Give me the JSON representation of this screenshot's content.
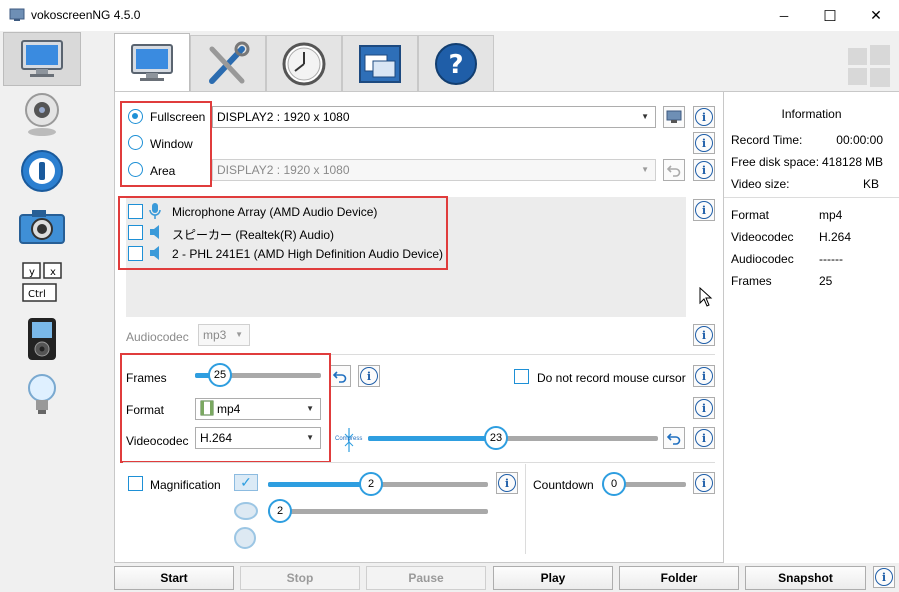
{
  "window": {
    "title": "vokoscreenNG 4.5.0",
    "minimize_glyph": "─",
    "maximize_glyph": "☐",
    "close_glyph": "✕"
  },
  "sidebar": {
    "items": [
      {
        "icon": "monitor-icon",
        "active": true
      },
      {
        "icon": "webcam-icon"
      },
      {
        "icon": "player-icon"
      },
      {
        "icon": "camera-icon"
      },
      {
        "icon": "keyboard-icon",
        "keys": [
          "y",
          "x",
          "Ctrl"
        ]
      },
      {
        "icon": "media-player-icon"
      },
      {
        "icon": "lightbulb-icon"
      }
    ]
  },
  "tabs": [
    {
      "icon": "monitor-icon",
      "active": true
    },
    {
      "icon": "tools-icon"
    },
    {
      "icon": "clock-icon"
    },
    {
      "icon": "window-icon"
    },
    {
      "icon": "help-icon",
      "glyph": "?"
    }
  ],
  "capture": {
    "modes": [
      {
        "label": "Fullscreen",
        "selected": true
      },
      {
        "label": "Window",
        "selected": false
      },
      {
        "label": "Area",
        "selected": false
      }
    ],
    "fullscreen_display": "DISPLAY2 : 1920 x 1080",
    "area_display": "DISPLAY2 : 1920 x 1080"
  },
  "audio": {
    "devices": [
      {
        "label": "Microphone Array (AMD Audio Device)",
        "icon": "microphone-icon",
        "checked": false
      },
      {
        "label": "スピーカー (Realtek(R) Audio)",
        "icon": "speaker-icon",
        "checked": false
      },
      {
        "label": "2 - PHL 241E1 (AMD High Definition Audio Device)",
        "icon": "speaker-icon",
        "checked": false
      }
    ],
    "codec_label": "Audiocodec",
    "codec_value": "mp3"
  },
  "video": {
    "frames_label": "Frames",
    "frames_value": "25",
    "frames_fraction": 0.2,
    "format_label": "Format",
    "format_value": "mp4",
    "videocodec_label": "Videocodec",
    "videocodec_value": "H.264",
    "mouse_cursor_label": "Do not record mouse cursor",
    "compress_label": "Compress",
    "compress_value": "23",
    "compress_fraction": 0.44
  },
  "magnification": {
    "label": "Magnification",
    "value_a": "2",
    "value_b": "2",
    "fraction_a": 0.47,
    "countdown_label": "Countdown",
    "countdown_value": "0"
  },
  "info": {
    "title": "Information",
    "rows": [
      {
        "key": "Record Time:",
        "value": "00:00:00"
      },
      {
        "key": "Free disk space:",
        "value": "418128",
        "unit": "MB"
      },
      {
        "key": "Video size:",
        "value": "",
        "unit": "KB"
      }
    ],
    "details": [
      {
        "key": "Format",
        "value": "mp4"
      },
      {
        "key": "Videocodec",
        "value": "H.264"
      },
      {
        "key": "Audiocodec",
        "value": "------"
      },
      {
        "key": "Frames",
        "value": "25"
      }
    ]
  },
  "buttons": {
    "start": "Start",
    "stop": "Stop",
    "pause": "Pause",
    "play": "Play",
    "folder": "Folder",
    "snapshot": "Snapshot"
  },
  "colors": {
    "accent": "#2e9ee0",
    "highlight": "#e03c3c",
    "info_icon": "#1f5ea8"
  }
}
